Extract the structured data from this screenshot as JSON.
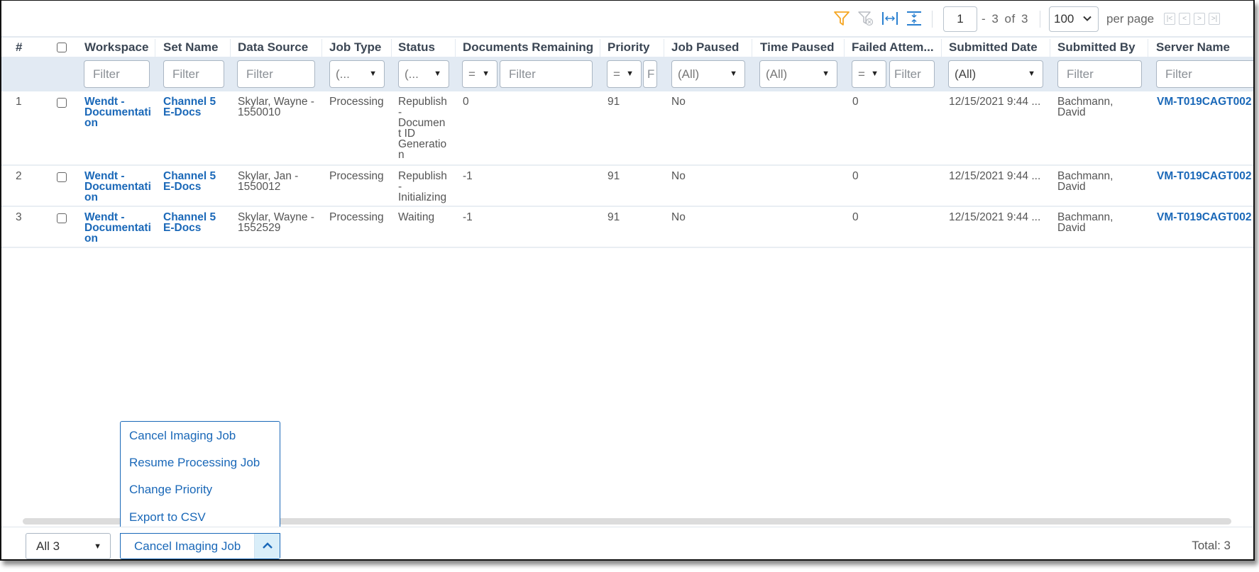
{
  "toolbar": {
    "icons": [
      "filter-icon",
      "clear-filter-icon",
      "fit-columns-icon",
      "fit-rows-icon"
    ],
    "accent_filter_color": "#f5a623",
    "page_input_value": "1",
    "page_range_text": "- 3  of  3",
    "per_page_value": "100",
    "per_page_label": "per page",
    "pager_buttons": [
      "first-page",
      "previous-page",
      "next-page",
      "last-page"
    ]
  },
  "columns": [
    {
      "key": "num",
      "label": "#"
    },
    {
      "key": "select",
      "label": ""
    },
    {
      "key": "workspace",
      "label": "Workspace"
    },
    {
      "key": "set_name",
      "label": "Set Name"
    },
    {
      "key": "data_source",
      "label": "Data Source"
    },
    {
      "key": "job_type",
      "label": "Job Type"
    },
    {
      "key": "status",
      "label": "Status"
    },
    {
      "key": "docs_remaining",
      "label": "Documents Remaining"
    },
    {
      "key": "priority",
      "label": "Priority"
    },
    {
      "key": "job_paused",
      "label": "Job Paused"
    },
    {
      "key": "time_paused",
      "label": "Time Paused"
    },
    {
      "key": "failed_attempts",
      "label": "Failed Attem..."
    },
    {
      "key": "submitted_date",
      "label": "Submitted Date"
    },
    {
      "key": "submitted_by",
      "label": "Submitted By"
    },
    {
      "key": "server_name",
      "label": "Server Name"
    }
  ],
  "filters": {
    "workspace": "Filter",
    "set_name": "Filter",
    "data_source": "Filter",
    "job_type": "(...",
    "status": "(...",
    "docs_remaining_op": "=",
    "docs_remaining": "Filter",
    "priority_op": "=",
    "priority": "F",
    "job_paused": "(All)",
    "time_paused": "(All)",
    "failed_attempts_op": "=",
    "failed_attempts": "Filter",
    "submitted_date": "(All)",
    "submitted_by": "Filter",
    "server_name": "Filter"
  },
  "rows": [
    {
      "num": "1",
      "workspace": [
        "Wendt -",
        "Documentati",
        "on"
      ],
      "set_name": [
        "Channel 5",
        "E-Docs"
      ],
      "data_source": [
        "Skylar, Wayne -",
        "1550010"
      ],
      "job_type": "Processing",
      "status": [
        "Republish",
        "-",
        "Documen",
        "t ID",
        "Generatio",
        "n"
      ],
      "docs_remaining": "0",
      "priority": "91",
      "job_paused": "No",
      "time_paused": "",
      "failed_attempts": "0",
      "submitted_date": "12/15/2021 9:44 ...",
      "submitted_by": [
        "Bachmann,",
        "David"
      ],
      "server_name": "VM-T019CAGT002"
    },
    {
      "num": "2",
      "workspace": [
        "Wendt -",
        "Documentati",
        "on"
      ],
      "set_name": [
        "Channel 5",
        "E-Docs"
      ],
      "data_source": [
        "Skylar, Jan -",
        "1550012"
      ],
      "job_type": "Processing",
      "status": [
        "Republish",
        "-",
        "Initializing"
      ],
      "docs_remaining": "-1",
      "priority": "91",
      "job_paused": "No",
      "time_paused": "",
      "failed_attempts": "0",
      "submitted_date": "12/15/2021 9:44 ...",
      "submitted_by": [
        "Bachmann,",
        "David"
      ],
      "server_name": "VM-T019CAGT002"
    },
    {
      "num": "3",
      "workspace": [
        "Wendt -",
        "Documentati",
        "on"
      ],
      "set_name": [
        "Channel 5",
        "E-Docs"
      ],
      "data_source": [
        "Skylar, Wayne -",
        "1552529"
      ],
      "job_type": "Processing",
      "status": [
        "Waiting"
      ],
      "docs_remaining": "-1",
      "priority": "91",
      "job_paused": "No",
      "time_paused": "",
      "failed_attempts": "0",
      "submitted_date": "12/15/2021 9:44 ...",
      "submitted_by": [
        "Bachmann,",
        "David"
      ],
      "server_name": "VM-T019CAGT002"
    }
  ],
  "mass_action_menu": {
    "items": [
      "Cancel Imaging Job",
      "Resume Processing Job",
      "Change Priority",
      "Export to CSV"
    ]
  },
  "footer": {
    "selection_scope": "All 3",
    "selected_action": "Cancel Imaging Job",
    "total_text": "Total: 3"
  },
  "colors": {
    "link": "#1a68b8",
    "filter_row_bg": "#e2eaf3",
    "filter_icon_active": "#f5a623"
  }
}
